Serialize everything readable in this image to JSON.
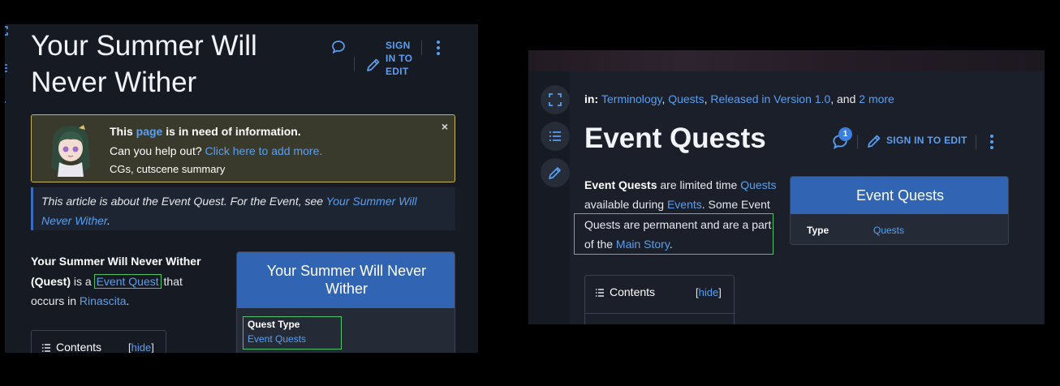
{
  "left": {
    "title": "Your Summer Will Never Wither",
    "signin_label": "SIGN IN TO EDIT",
    "notice": {
      "this": "This ",
      "page_link": "page",
      "need": " is in need of information.",
      "help_text": "Can you help out? ",
      "add_link": "Click here to add more.",
      "missing": "CGs, cutscene summary",
      "close": "×"
    },
    "hatnote": {
      "text": "This article is about the Event Quest. For the Event, see ",
      "link": "Your Summer Will Never Wither",
      "end": "."
    },
    "intro": {
      "bold": "Your Summer Will Never Wither (Quest)",
      "is_a": " is a ",
      "link1": "Event Quest",
      "mid": " that occurs in ",
      "link2": "Rinascita",
      "end": "."
    },
    "toc": {
      "title": "Contents",
      "bracket_open": "[",
      "hide": "hide",
      "bracket_close": "]"
    },
    "infobox": {
      "title": "Your Summer Will Never Wither",
      "label": "Quest Type",
      "value": "Event Quests"
    }
  },
  "right": {
    "cats": {
      "prefix": "in: ",
      "c1": "Terminology",
      "sep1": ", ",
      "c2": "Quests",
      "sep2": ", ",
      "c3": "Released in Version 1.0",
      "and": ", and ",
      "more": "2 more"
    },
    "title": "Event Quests",
    "comment_count": "1",
    "signin_label": "SIGN IN TO EDIT",
    "intro": {
      "bold": "Event Quests",
      "t1": " are limited time ",
      "l1": "Quests",
      "t2": " available during ",
      "l2": "Events",
      "t3": ". Some Event Quests are permanent and are a part of the ",
      "l3": "Main Story",
      "t4": "."
    },
    "infobox": {
      "title": "Event Quests",
      "label": "Type",
      "value": "Quests"
    },
    "toc": {
      "title": "Contents",
      "bracket_open": "[",
      "hide": "hide",
      "bracket_close": "]"
    }
  },
  "colors": {
    "background": "#161a22",
    "link": "#5a9ff0",
    "infobox_header": "#3165b3",
    "highlight": "#4dc46a",
    "notice_border": "#c9b650"
  },
  "icons": [
    "comment-icon",
    "pencil-icon",
    "kebab-icon",
    "expand-icon",
    "list-icon",
    "toc-icon"
  ]
}
